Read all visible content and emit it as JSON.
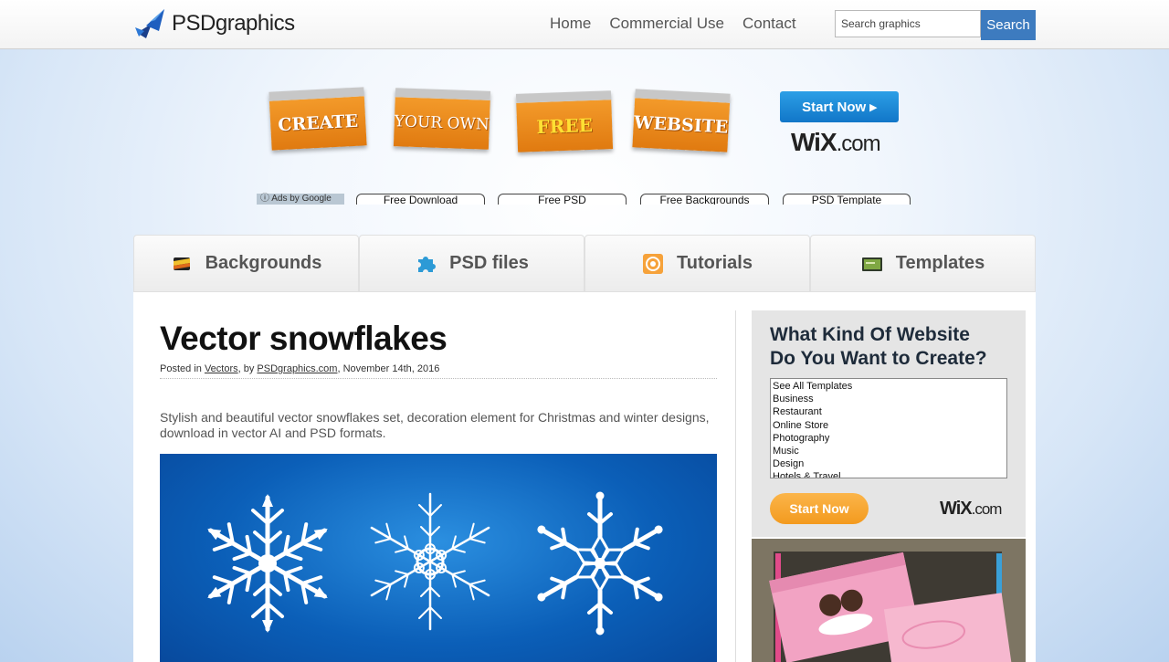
{
  "header": {
    "logo_text": "PSDgraphics",
    "nav": [
      "Home",
      "Commercial Use",
      "Contact"
    ],
    "search_placeholder": "Search graphics",
    "search_button": "Search"
  },
  "ad_banner": {
    "tiles": [
      "CREATE",
      "YOUR OWN",
      "FREE",
      "WEBSITE"
    ],
    "start_now": "Start Now",
    "wix_brand": "WiX",
    "wix_suffix": ".com"
  },
  "ad_links": {
    "ads_by": "Ads by Google",
    "links": [
      "Free Download",
      "Free PSD",
      "Free Backgrounds",
      "PSD Template"
    ]
  },
  "tabs": [
    {
      "label": "Backgrounds",
      "icon": "backgrounds-icon"
    },
    {
      "label": "PSD files",
      "icon": "puzzle-icon"
    },
    {
      "label": "Tutorials",
      "icon": "tutorials-icon"
    },
    {
      "label": "Templates",
      "icon": "templates-icon"
    }
  ],
  "post": {
    "title": "Vector snowflakes",
    "meta_prefix": "Posted in",
    "category": "Vectors",
    "meta_by": ", by",
    "author": "PSDgraphics.com",
    "date": ", November 14th, 2016",
    "description": "Stylish and beautiful vector snowflakes set, decoration element for Christmas and winter designs, download in vector AI and PSD formats."
  },
  "sidebar_ad": {
    "title_line1": "What Kind Of Website",
    "title_line2": "Do You Want to Create?",
    "options": [
      "See All Templates",
      "Business",
      "Restaurant",
      "Online Store",
      "Photography",
      "Music",
      "Design",
      "Hotels & Travel"
    ],
    "start_now": "Start Now",
    "wix_brand": "WiX",
    "wix_suffix": ".com"
  },
  "colors": {
    "search_button": "#3d7bbf",
    "tile_orange": "#f08c1e",
    "wix_blue": "#1a8ad8",
    "sidebar_orange": "#f7a535",
    "snowflake_bg": "#0b5fb8"
  }
}
